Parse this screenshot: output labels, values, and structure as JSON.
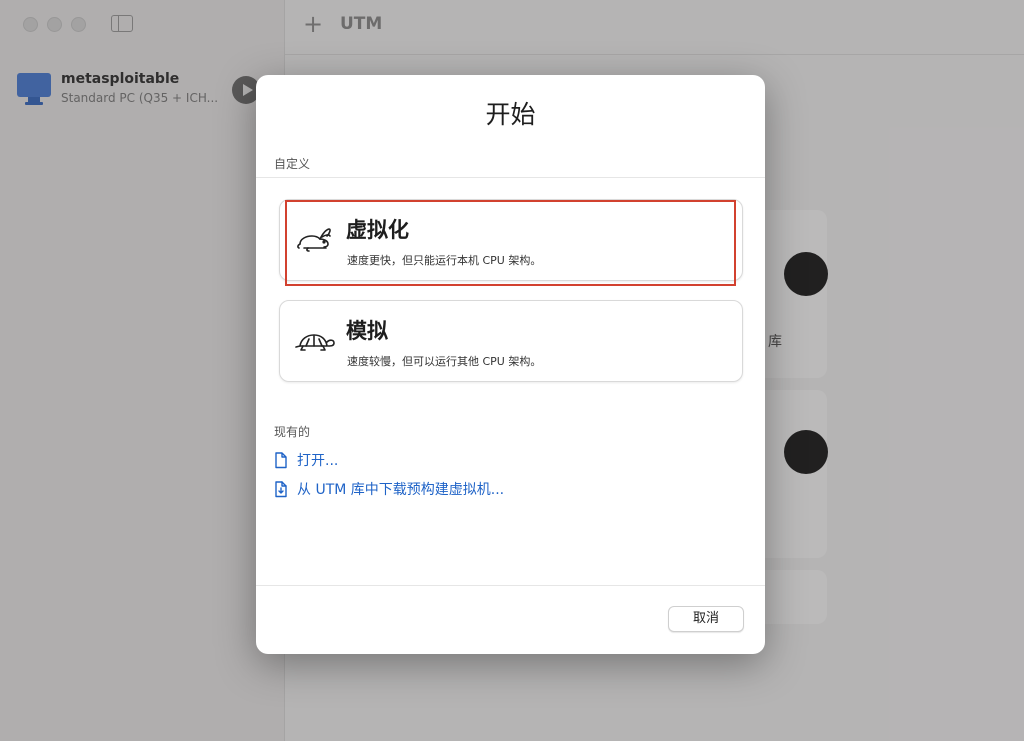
{
  "window": {
    "toolbar_plus": "+",
    "title": "UTM"
  },
  "sidebar": {
    "vm": {
      "name": "metasploitable",
      "subtitle": "Standard PC (Q35 + ICH..."
    }
  },
  "background": {
    "library_text": "库"
  },
  "dialog": {
    "title": "开始",
    "custom_section": "自定义",
    "options": [
      {
        "title": "虚拟化",
        "desc": "速度更快，但只能运行本机 CPU 架构。",
        "icon": "rabbit-icon",
        "highlighted": true
      },
      {
        "title": "模拟",
        "desc": "速度较慢，但可以运行其他 CPU 架构。",
        "icon": "turtle-icon"
      }
    ],
    "existing_section": "现有的",
    "links": [
      {
        "label": "打开...",
        "icon": "document-icon"
      },
      {
        "label": "从 UTM 库中下载预构建虚拟机...",
        "icon": "download-document-icon"
      }
    ],
    "cancel_label": "取消"
  },
  "colors": {
    "accent": "#1f63c7",
    "highlight_border": "#d2412f"
  }
}
